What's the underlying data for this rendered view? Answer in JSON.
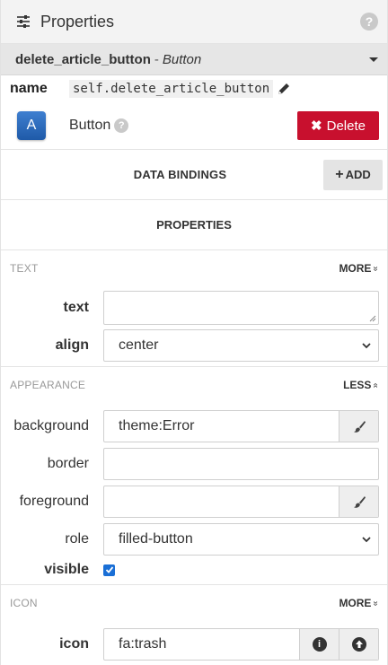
{
  "header": {
    "title": "Properties",
    "help": "?"
  },
  "component": {
    "name": "delete_article_button",
    "separator": "-",
    "type": "Button"
  },
  "name_row": {
    "label": "name",
    "value": "self.delete_article_button"
  },
  "type_row": {
    "icon_letter": "A",
    "type_name": "Button",
    "help": "?",
    "delete_label": "Delete",
    "delete_icon": "✖"
  },
  "data_bindings": {
    "title": "DATA BINDINGS",
    "add_label": "ADD",
    "add_icon": "+"
  },
  "properties_title": "PROPERTIES",
  "sections": {
    "text": {
      "name": "TEXT",
      "toggle": "MORE",
      "chevron": "»"
    },
    "appearance": {
      "name": "APPEARANCE",
      "toggle": "LESS",
      "chevron": "»"
    },
    "icon": {
      "name": "ICON",
      "toggle": "MORE",
      "chevron": "»"
    }
  },
  "props": {
    "text": {
      "label": "text",
      "value": ""
    },
    "align": {
      "label": "align",
      "value": "center"
    },
    "background": {
      "label": "background",
      "value": "theme:Error"
    },
    "border": {
      "label": "border",
      "value": ""
    },
    "foreground": {
      "label": "foreground",
      "value": ""
    },
    "role": {
      "label": "role",
      "value": "filled-button"
    },
    "visible": {
      "label": "visible",
      "checked": true
    },
    "icon": {
      "label": "icon",
      "value": "fa:trash",
      "info_icon": "i"
    }
  },
  "colors": {
    "delete": "#c8102e",
    "checkbox": "#1a6fd6",
    "header_bg": "#f3f3f3"
  },
  "icons": [
    "sliders-icon",
    "help-icon",
    "chevron-down-icon",
    "pencil-icon",
    "brush-icon",
    "info-icon",
    "upload-icon"
  ]
}
